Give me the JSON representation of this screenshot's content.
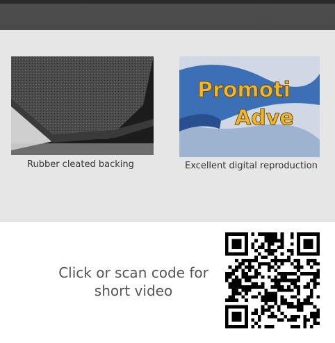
{
  "features": [
    {
      "caption": "Rubber cleated backing",
      "image": "rubber-cleated-backing-photo"
    },
    {
      "caption": "Excellent digital reproduction",
      "image": "printed-mat-closeup-photo",
      "image_text": "Promoti Adve"
    }
  ],
  "video": {
    "cta_line1": "Click or scan code for",
    "cta_line2": "short video",
    "qr": "video-qr-code"
  }
}
